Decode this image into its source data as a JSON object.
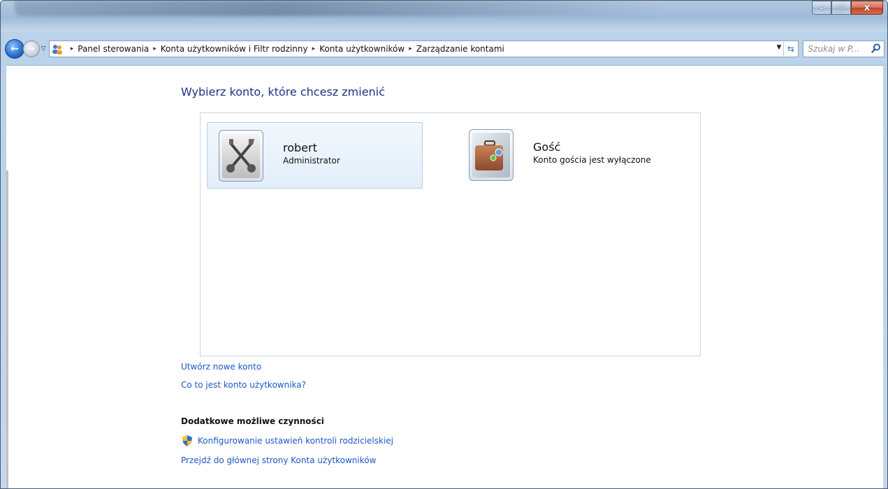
{
  "window": {
    "caption_buttons": {
      "minimize": "–",
      "maximize": "□",
      "close": "X"
    }
  },
  "address_bar": {
    "breadcrumbs": [
      "Panel sterowania",
      "Konta użytkowników i Filtr rodzinny",
      "Konta użytkowników",
      "Zarządzanie kontami"
    ],
    "separator": "▸"
  },
  "search": {
    "placeholder": "Szukaj w P..."
  },
  "main": {
    "heading": "Wybierz konto, które chcesz zmienić",
    "accounts": [
      {
        "name": "robert",
        "description": "Administrator",
        "selected": true,
        "picture_icon": "tools-icon"
      },
      {
        "name": "Gość",
        "description": "Konto gościa jest wyłączone",
        "selected": false,
        "picture_icon": "suitcase-icon"
      }
    ],
    "links": {
      "create_account": "Utwórz nowe konto",
      "what_is_account": "Co to jest konto użytkownika?"
    },
    "additional": {
      "title": "Dodatkowe możliwe czynności",
      "parental_controls": "Konfigurowanie ustawień kontroli rodzicielskiej",
      "main_page": "Przejdź do głównej strony Konta użytkowników"
    }
  },
  "colors": {
    "heading": "#1e3287",
    "link": "#1d57c7",
    "selected_bg": "#e6f0fb"
  }
}
